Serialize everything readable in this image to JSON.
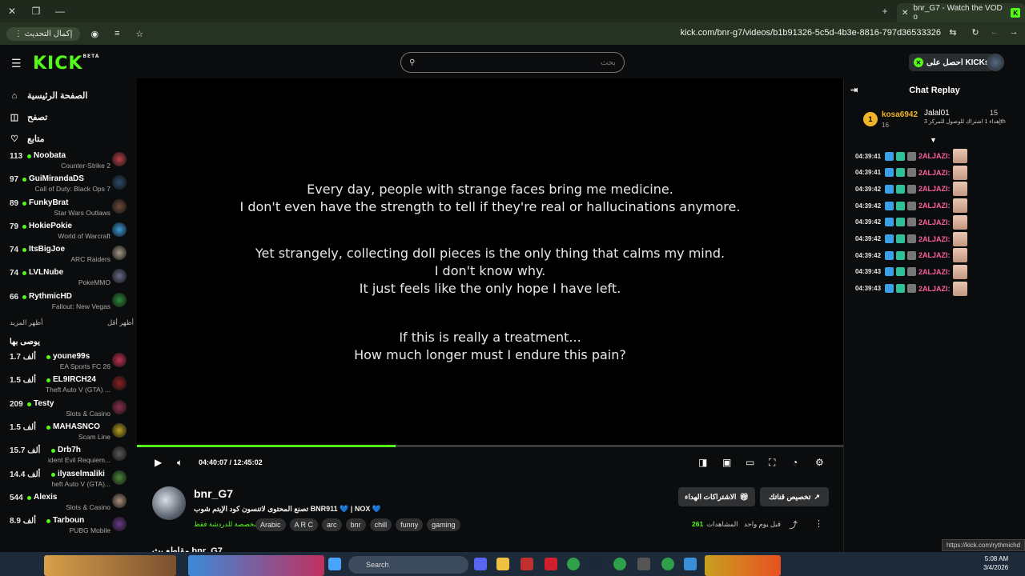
{
  "browser": {
    "tab_title": "bnr_G7 - Watch the VOD o",
    "update_label": "إكمال التحديث",
    "url": "kick.com/bnr-g7/videos/b1b91326-5c5d-4b3e-8816-797d36533326"
  },
  "header": {
    "logo": "KICK",
    "logo_beta": "BETA",
    "search_placeholder": "بحث",
    "get_kicks": "احصل على KICKs"
  },
  "sidebar": {
    "nav": [
      {
        "label": "الصفحة الرئيسية",
        "icon": "⌂"
      },
      {
        "label": "تصفح",
        "icon": "◫"
      },
      {
        "label": "متابع",
        "icon": "♡"
      }
    ],
    "following": [
      {
        "count": "113",
        "name": "Noobata",
        "game": "Counter-Strike 2",
        "color": "#b9404a"
      },
      {
        "count": "97",
        "name": "GuiMirandaDS",
        "game": "Call of Duty: Black Ops 7",
        "color": "#2d4a6b"
      },
      {
        "count": "89",
        "name": "FunkyBrat",
        "game": "Star Wars Outlaws",
        "color": "#6b4a3a"
      },
      {
        "count": "79",
        "name": "HokiePokie",
        "game": "World of Warcraft",
        "color": "#3a9bd8"
      },
      {
        "count": "74",
        "name": "ItsBigJoe",
        "game": "ARC Raiders",
        "color": "#a59a88"
      },
      {
        "count": "74",
        "name": "LVLNube",
        "game": "PokeMMO",
        "color": "#6a6a8a"
      },
      {
        "count": "66",
        "name": "RythmicHD",
        "game": "Fallout: New Vegas",
        "color": "#2f8a3a"
      }
    ],
    "show_more": "أظهر المزيد",
    "show_less": "أظهر أقل",
    "recommended_title": "يوصى بها",
    "recommended": [
      {
        "count": "1.7 ألف",
        "name": "youne99s",
        "game": "EA Sports FC 26",
        "color": "#c03050"
      },
      {
        "count": "1.5 ألف",
        "name": "EL9IRCH24",
        "game": "Theft Auto V (GTA) ...",
        "color": "#8a2020"
      },
      {
        "count": "209",
        "name": "Testy",
        "game": "Slots & Casino",
        "color": "#8a3050"
      },
      {
        "count": "1.5 ألف",
        "name": "MAHASNCO",
        "game": "Scam Line",
        "color": "#b8a020"
      },
      {
        "count": "15.7 ألف",
        "name": "Drb7h",
        "game": "ident Evil Requiem...",
        "color": "#5a5a5a"
      },
      {
        "count": "14.4 ألف",
        "name": "ilyaselmaliki",
        "game": "heft Auto V (GTA)...",
        "color": "#4a8a3a"
      },
      {
        "count": "544",
        "name": "Alexis",
        "game": "Slots & Casino",
        "color": "#b09080"
      },
      {
        "count": "8.9 ألف",
        "name": "Tarboun",
        "game": "PUBG Mobile",
        "color": "#6a3a8a"
      }
    ]
  },
  "video": {
    "subtitle_block_1": [
      "Every day, people with strange faces bring me medicine.",
      "I don't even have the strength to tell if they're real or hallucinations anymore."
    ],
    "subtitle_block_2": [
      "Yet strangely, collecting doll pieces is the only thing that calms my mind.",
      "I don't know why.",
      "It just feels like the only hope I have left."
    ],
    "subtitle_block_3": [
      "If this is really a treatment...",
      "How much longer must I endure this pain?"
    ],
    "current_time": "04:40:07",
    "duration": "12:45:02",
    "progress": 0.366
  },
  "channel": {
    "name": "bnr_G7",
    "title": "تصنع المحتوى لاتنسون كود الإيتم شوب BNR911 💙 | NOX 💙",
    "tagline": "مخصصة للدردشة فقط",
    "tags": [
      "Arabic",
      "A R C",
      "arc",
      "bnr",
      "chill",
      "funny",
      "gaming"
    ],
    "gift_subs": "الاشتراكات الهداء",
    "clip": "تخصيص قناتك",
    "views_label": "المشاهدات",
    "views": "261",
    "ago": "قبل يوم واحد",
    "below_title": "مقاطع بث bnr_G7"
  },
  "chat": {
    "title": "Chat Replay",
    "pinned": {
      "rank": "1",
      "user": "kosa6942",
      "sub_months": "16",
      "gifter": "Jalal01",
      "gift_text": "إهداء 1 اشتراك للوصول للمركز 3th",
      "gift_count": "15"
    },
    "messages": [
      {
        "ts": "04:39:41",
        "user": "2ALJAZI:"
      },
      {
        "ts": "04:39:41",
        "user": "2ALJAZI:"
      },
      {
        "ts": "04:39:42",
        "user": "2ALJAZI:"
      },
      {
        "ts": "04:39:42",
        "user": "2ALJAZI:"
      },
      {
        "ts": "04:39:42",
        "user": "2ALJAZI:"
      },
      {
        "ts": "04:39:42",
        "user": "2ALJAZI:"
      },
      {
        "ts": "04:39:42",
        "user": "2ALJAZI:"
      },
      {
        "ts": "04:39:43",
        "user": "2ALJAZI:"
      },
      {
        "ts": "04:39:43",
        "user": "2ALJAZI:"
      }
    ]
  },
  "taskbar": {
    "search": "Search",
    "time": "5:08 AM",
    "date": "3/4/2026"
  },
  "status_bar_url": "https://kick.com/rythmichd"
}
